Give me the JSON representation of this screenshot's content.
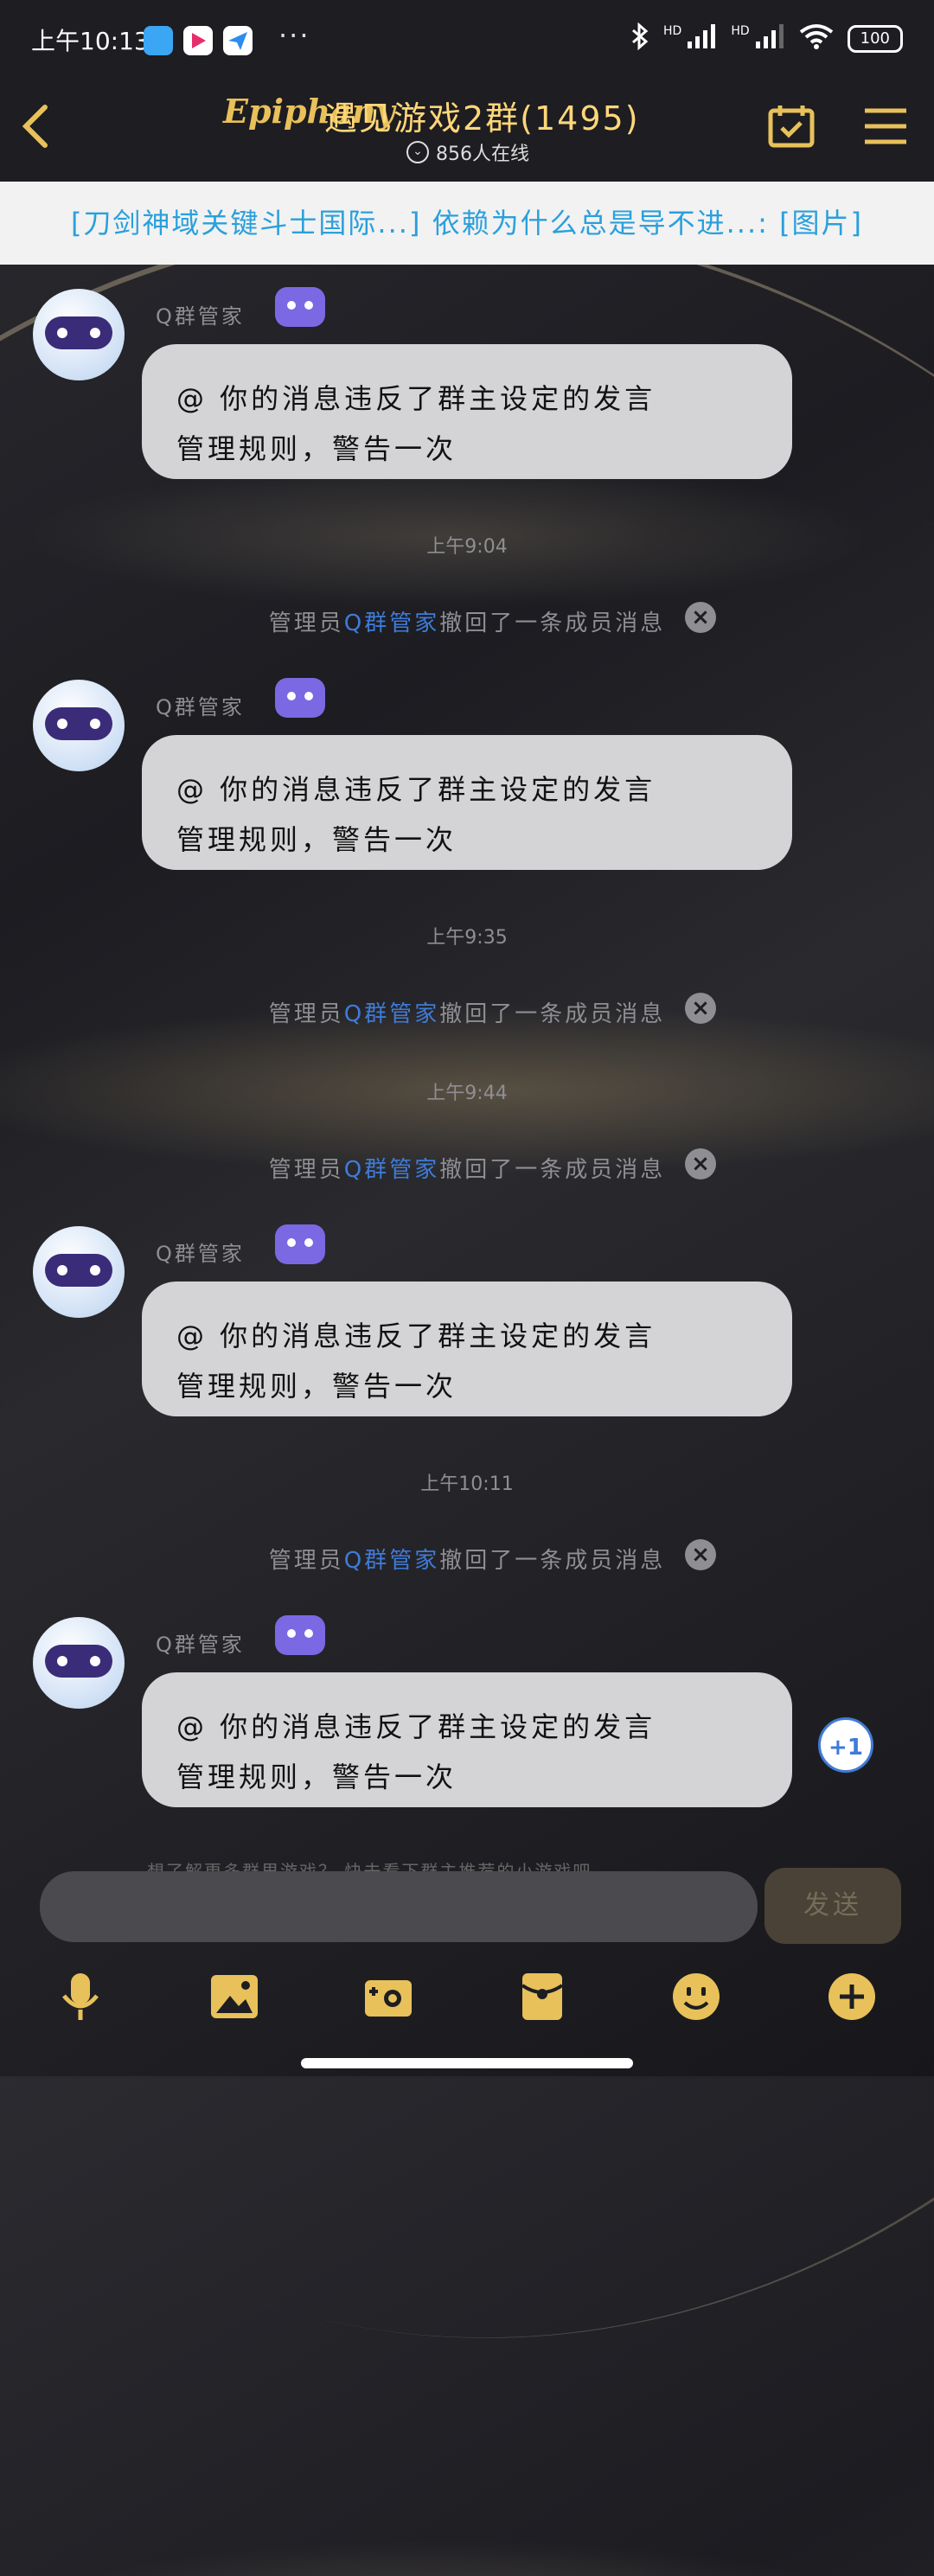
{
  "status_bar": {
    "time": "上午10:13",
    "network_1": "HD",
    "network_2": "HD",
    "battery": "100"
  },
  "header": {
    "logo_text": "Epiphany",
    "title": "遇见游戏2群(1495)",
    "online": "856人在线"
  },
  "announcement": "[刀剑神域关键斗士国际...] 依赖为什么总是导不进...: [图片]",
  "messages": [
    {
      "sender": "Q群管家",
      "text_line1": "@ 你的消息违反了群主设定的发言",
      "text_line2": "管理规则，警告一次"
    },
    {
      "sender": "Q群管家",
      "text_line1": "@ 你的消息违反了群主设定的发言",
      "text_line2": "管理规则，警告一次"
    },
    {
      "sender": "Q群管家",
      "text_line1": "@ 你的消息违反了群主设定的发言",
      "text_line2": "管理规则，警告一次"
    },
    {
      "sender": "Q群管家",
      "text_line1": "@ 你的消息违反了群主设定的发言",
      "text_line2": "管理规则，警告一次"
    }
  ],
  "time_labels": [
    "上午9:04",
    "上午9:35",
    "上午9:44",
    "上午10:11"
  ],
  "recall": {
    "prefix": "管理员",
    "admin": "Q群管家",
    "suffix": "撤回了一条成员消息"
  },
  "plus_one": "+1",
  "draft_hint": "想了解更多群里游戏？ 快去看下群主推荐的小游戏吧。",
  "input": {
    "placeholder": "",
    "send_label": "发送"
  },
  "toolbar": [
    "mic-icon",
    "image-icon",
    "camera-icon",
    "red-packet-icon",
    "emoji-icon",
    "plus-icon"
  ],
  "colors": {
    "title": "#ffd778",
    "admin_link": "#3f7bd8",
    "announcement_text": "#2aa0dc",
    "robot_badge": "#7b68e3"
  }
}
